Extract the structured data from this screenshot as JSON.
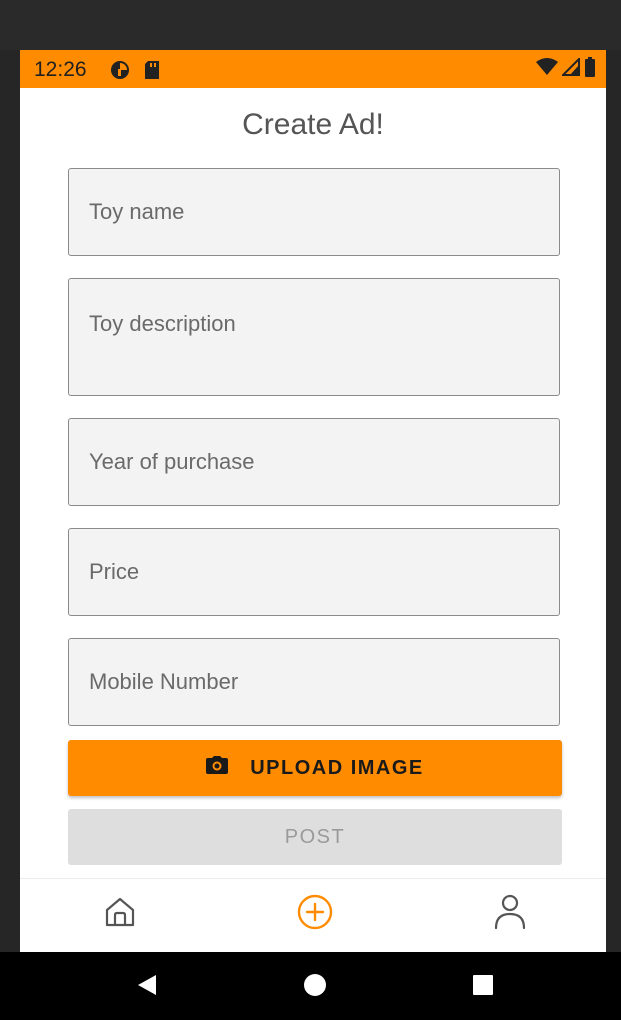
{
  "status_bar": {
    "time": "12:26",
    "color": "#ff8c00",
    "icons": [
      "wifi-icon",
      "signal-icon",
      "battery-icon"
    ]
  },
  "page": {
    "title": "Create Ad!"
  },
  "form": {
    "toy_name": {
      "placeholder": "Toy name",
      "value": ""
    },
    "toy_description": {
      "placeholder": "Toy description",
      "value": ""
    },
    "year_of_purchase": {
      "placeholder": "Year of purchase",
      "value": ""
    },
    "price": {
      "placeholder": "Price",
      "value": ""
    },
    "mobile_number": {
      "placeholder": "Mobile Number",
      "value": ""
    }
  },
  "buttons": {
    "upload_label": "UPLOAD IMAGE",
    "upload_icon": "camera-icon",
    "post_label": "POST"
  },
  "bottom_nav": {
    "items": [
      {
        "icon": "home-icon",
        "active": false
      },
      {
        "icon": "add-circle-icon",
        "active": true
      },
      {
        "icon": "profile-icon",
        "active": false
      }
    ],
    "accent": "#ff8c00"
  },
  "system_nav": {
    "icons": [
      "back-icon",
      "home-circle-icon",
      "recents-icon"
    ]
  }
}
